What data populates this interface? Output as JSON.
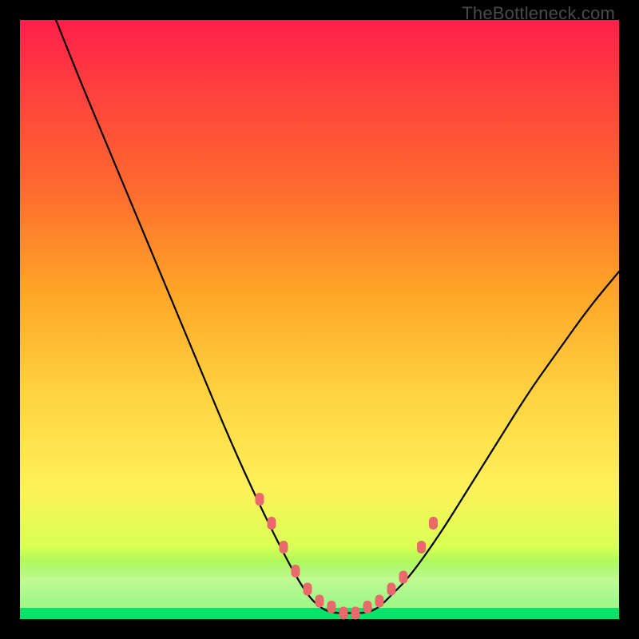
{
  "watermark": "TheBottleneck.com",
  "colors": {
    "dot": "#e86a6a",
    "curve": "#000000",
    "green": "#00e46a"
  },
  "chart_data": {
    "type": "line",
    "title": "",
    "xlabel": "",
    "ylabel": "",
    "xlim": [
      0,
      100
    ],
    "ylim": [
      0,
      100
    ],
    "grid": false,
    "legend": false,
    "series": [
      {
        "name": "bottleneck-curve",
        "x": [
          6,
          10,
          15,
          20,
          25,
          30,
          35,
          40,
          45,
          48,
          50,
          52,
          55,
          58,
          60,
          62,
          65,
          70,
          75,
          80,
          85,
          90,
          95,
          100
        ],
        "y": [
          100,
          90,
          78,
          66,
          54,
          42,
          30,
          19,
          9,
          4,
          2,
          1,
          1,
          1,
          2,
          4,
          7,
          14,
          22,
          30,
          38,
          45,
          52,
          58
        ]
      }
    ],
    "markers": {
      "name": "highlighted-points",
      "x": [
        40,
        42,
        44,
        46,
        48,
        50,
        52,
        54,
        56,
        58,
        60,
        62,
        64,
        67,
        69
      ],
      "y": [
        20,
        16,
        12,
        8,
        5,
        3,
        2,
        1,
        1,
        2,
        3,
        5,
        7,
        12,
        16
      ]
    }
  }
}
